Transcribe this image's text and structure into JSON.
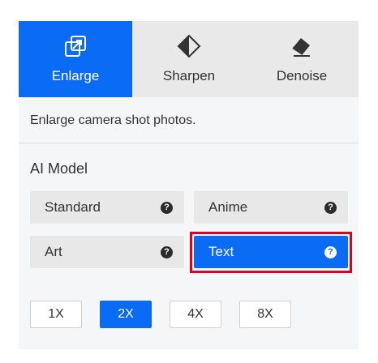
{
  "tabs": [
    {
      "label": "Enlarge",
      "icon": "enlarge-icon",
      "active": true
    },
    {
      "label": "Sharpen",
      "icon": "sharpen-icon",
      "active": false
    },
    {
      "label": "Denoise",
      "icon": "denoise-icon",
      "active": false
    }
  ],
  "description": "Enlarge camera shot photos.",
  "ai_model": {
    "title": "AI Model",
    "options": [
      {
        "label": "Standard",
        "selected": false
      },
      {
        "label": "Anime",
        "selected": false
      },
      {
        "label": "Art",
        "selected": false
      },
      {
        "label": "Text",
        "selected": true
      }
    ],
    "help_glyph": "?"
  },
  "scale": {
    "options": [
      "1X",
      "2X",
      "4X",
      "8X"
    ],
    "selected": "2X"
  },
  "colors": {
    "accent": "#0a6cf5",
    "highlight_border": "#e3001b",
    "tab_bar": "#e9e9ea",
    "panel_bg": "#f5f6f8"
  }
}
